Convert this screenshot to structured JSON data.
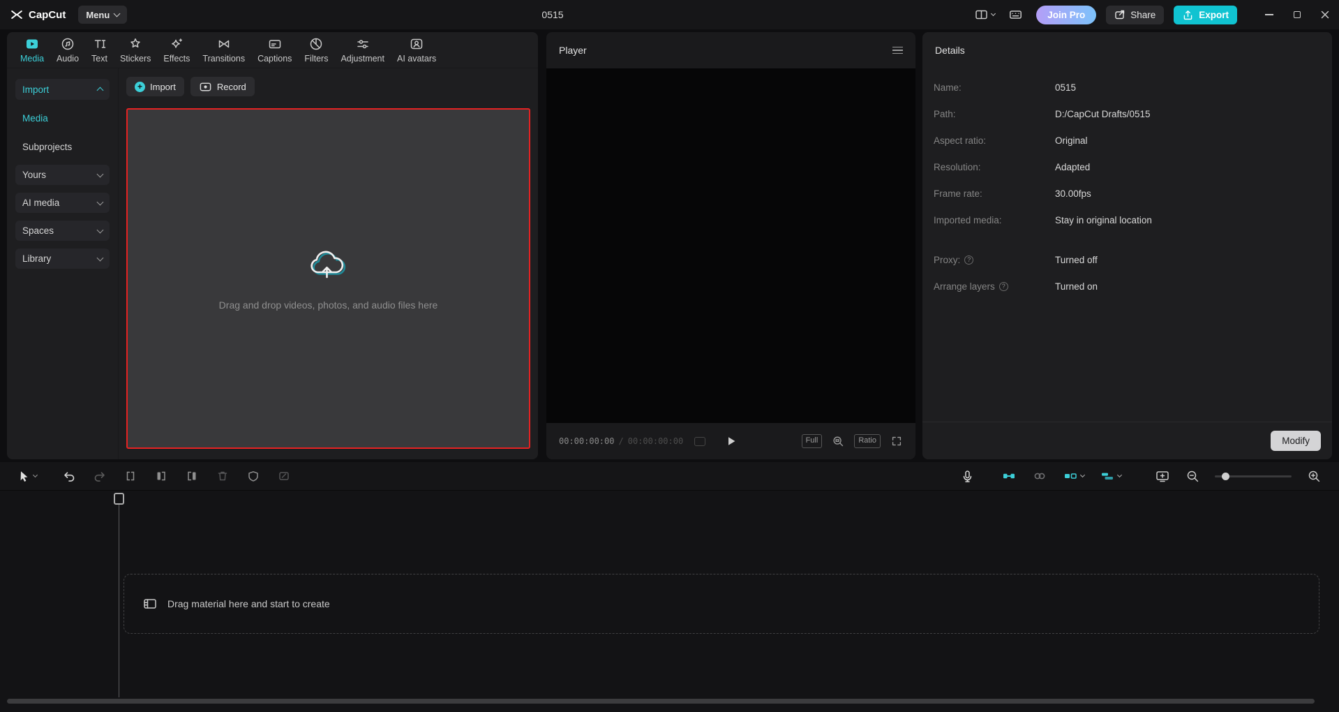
{
  "titlebar": {
    "app_name": "CapCut",
    "menu": "Menu",
    "project_title": "0515",
    "join_pro": "Join Pro",
    "share": "Share",
    "export": "Export"
  },
  "media_tabs": [
    {
      "label": "Media"
    },
    {
      "label": "Audio"
    },
    {
      "label": "Text"
    },
    {
      "label": "Stickers"
    },
    {
      "label": "Effects"
    },
    {
      "label": "Transitions"
    },
    {
      "label": "Captions"
    },
    {
      "label": "Filters"
    },
    {
      "label": "Adjustment"
    },
    {
      "label": "AI avatars"
    }
  ],
  "sidebar": {
    "import": "Import",
    "media": "Media",
    "subprojects": "Subprojects",
    "yours": "Yours",
    "ai_media": "AI media",
    "spaces": "Spaces",
    "library": "Library"
  },
  "media_panel": {
    "import_button": "Import",
    "record_button": "Record",
    "dropzone_text": "Drag and drop videos, photos, and audio files here"
  },
  "player": {
    "title": "Player",
    "current_time": "00:00:00:00",
    "separator": "/",
    "total_time": "00:00:00:00",
    "full_label": "Full",
    "ratio_label": "Ratio"
  },
  "details": {
    "title": "Details",
    "rows": [
      {
        "label": "Name:",
        "value": "0515"
      },
      {
        "label": "Path:",
        "value": "D:/CapCut Drafts/0515"
      },
      {
        "label": "Aspect ratio:",
        "value": "Original"
      },
      {
        "label": "Resolution:",
        "value": "Adapted"
      },
      {
        "label": "Frame rate:",
        "value": "30.00fps"
      },
      {
        "label": "Imported media:",
        "value": "Stay in original location"
      },
      {
        "label": "Proxy:",
        "value": "Turned off"
      },
      {
        "label": "Arrange layers",
        "value": "Turned on"
      }
    ],
    "modify_button": "Modify"
  },
  "timeline": {
    "empty_text": "Drag material here and start to create"
  },
  "icons": {
    "plus_glyph": "+",
    "help_glyph": "?"
  },
  "colors": {
    "accent": "#3ccfd8",
    "export_bg": "#10c3d1",
    "highlight_red": "#e62222"
  }
}
